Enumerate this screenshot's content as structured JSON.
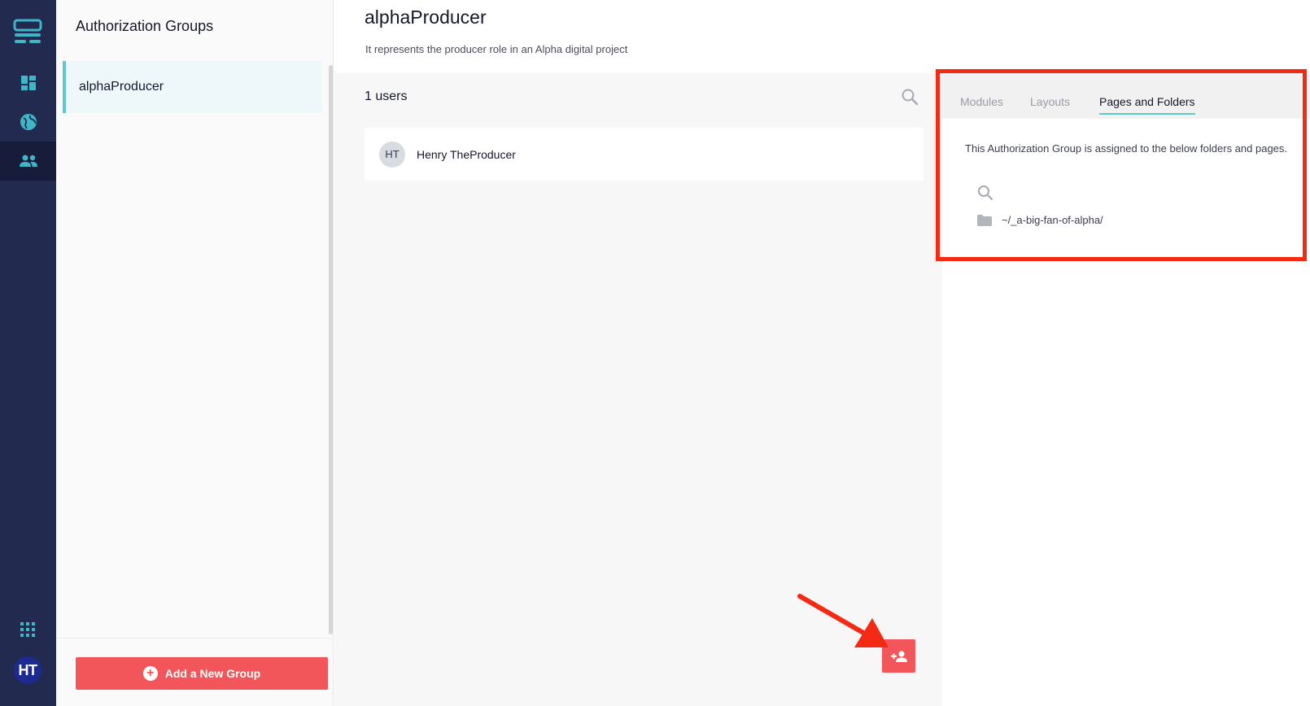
{
  "rail": {
    "icons": [
      "logo-icon",
      "dashboard-icon",
      "globe-icon",
      "users-icon",
      "apps-grid-icon"
    ],
    "active": "users-icon",
    "user_initials": "HT",
    "colors": {
      "background": "#222a4f",
      "active": "#171c3a",
      "accent": "#3fb6c8"
    }
  },
  "groups_panel": {
    "title": "Authorization Groups",
    "items": [
      {
        "label": "alphaProducer",
        "selected": true
      }
    ],
    "add_button_label": "Add a New Group"
  },
  "header": {
    "title": "alphaProducer",
    "subtitle": "It represents the producer role in an Alpha digital project"
  },
  "users": {
    "count_label": "1 users",
    "list": [
      {
        "initials": "HT",
        "name": "Henry TheProducer"
      }
    ]
  },
  "right_panel": {
    "tabs": [
      {
        "label": "Modules",
        "active": false
      },
      {
        "label": "Layouts",
        "active": false
      },
      {
        "label": "Pages and Folders",
        "active": true
      }
    ],
    "description": "This Authorization Group is assigned to the below folders and pages.",
    "folders": [
      {
        "path": "~/_a-big-fan-of-alpha/"
      }
    ]
  },
  "colors": {
    "primary_action": "#f2555a",
    "highlight_annotation": "#f52a14",
    "selection_accent": "#5ec7d6"
  }
}
